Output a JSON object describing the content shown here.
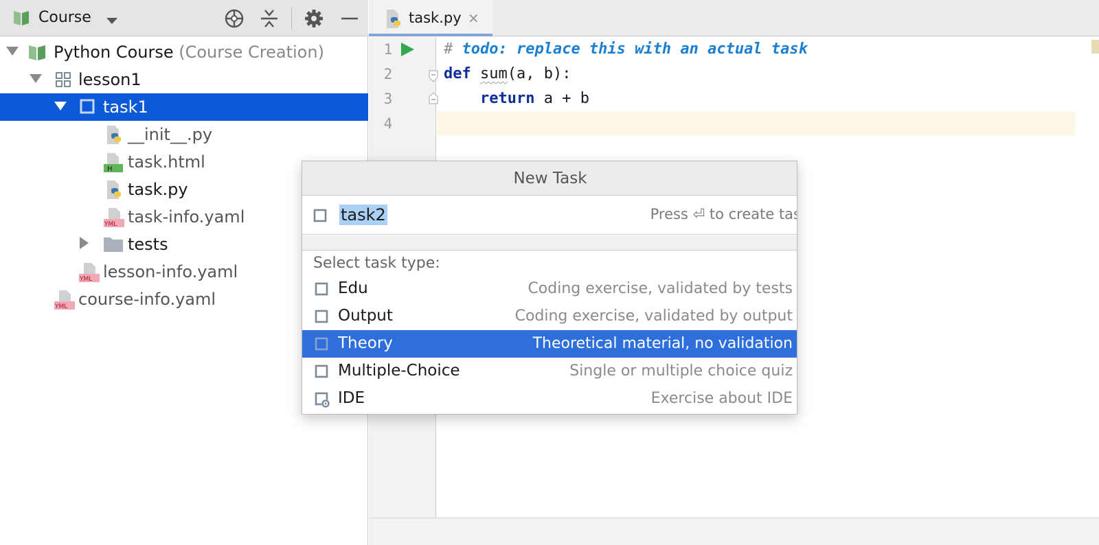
{
  "project_panel": {
    "title": "Course",
    "icons": [
      "book-icon",
      "chevron-down-icon",
      "locate-icon",
      "collapse-all-icon",
      "gear-icon",
      "minimize-icon"
    ]
  },
  "tree": [
    {
      "label": "Python Course",
      "suffix": "(Course Creation)",
      "icon": "course-book-icon"
    },
    {
      "label": "lesson1",
      "icon": "lesson-grid-icon"
    },
    {
      "label": "task1",
      "icon": "task-square-icon",
      "selected": true
    },
    {
      "label": "__init__.py",
      "icon": "python-file-icon"
    },
    {
      "label": "task.html",
      "icon": "html-file-icon",
      "badge": "H"
    },
    {
      "label": "task.py",
      "icon": "python-file-icon"
    },
    {
      "label": "task-info.yaml",
      "icon": "yaml-file-icon",
      "badge": "YML"
    },
    {
      "label": "tests",
      "icon": "folder-icon"
    },
    {
      "label": "lesson-info.yaml",
      "icon": "yaml-file-icon",
      "badge": "YML"
    },
    {
      "label": "course-info.yaml",
      "icon": "yaml-file-icon",
      "badge": "YML"
    }
  ],
  "editor": {
    "tab": {
      "label": "task.py",
      "close": "✕"
    },
    "line_numbers": [
      "1",
      "2",
      "3",
      "4"
    ],
    "code": {
      "line1_hash": "# ",
      "line1_todo": "todo: replace this with an actual task",
      "line2_kw": "def",
      "line2_fn": "sum",
      "line2_rest": "(a, b):",
      "line3_indent": "    ",
      "line3_kw": "return",
      "line3_rest": " a + b"
    }
  },
  "popup": {
    "title": "New Task",
    "input_value": "task2",
    "hint": "Press ⏎ to create tas",
    "section_label": "Select task type:",
    "options": [
      {
        "name": "Edu",
        "desc": "Coding exercise, validated by tests"
      },
      {
        "name": "Output",
        "desc": "Coding exercise, validated by output"
      },
      {
        "name": "Theory",
        "desc": "Theoretical material, no validation",
        "selected": true
      },
      {
        "name": "Multiple-Choice",
        "desc": "Single or multiple choice quiz"
      },
      {
        "name": "IDE",
        "desc": "Exercise about IDE"
      }
    ]
  },
  "colors": {
    "selection": "#0d5ad9",
    "popup_selection": "#2f6fdc",
    "keyword": "#0e2e9c",
    "todo": "#1b7fd1",
    "run": "#2fa84f"
  }
}
